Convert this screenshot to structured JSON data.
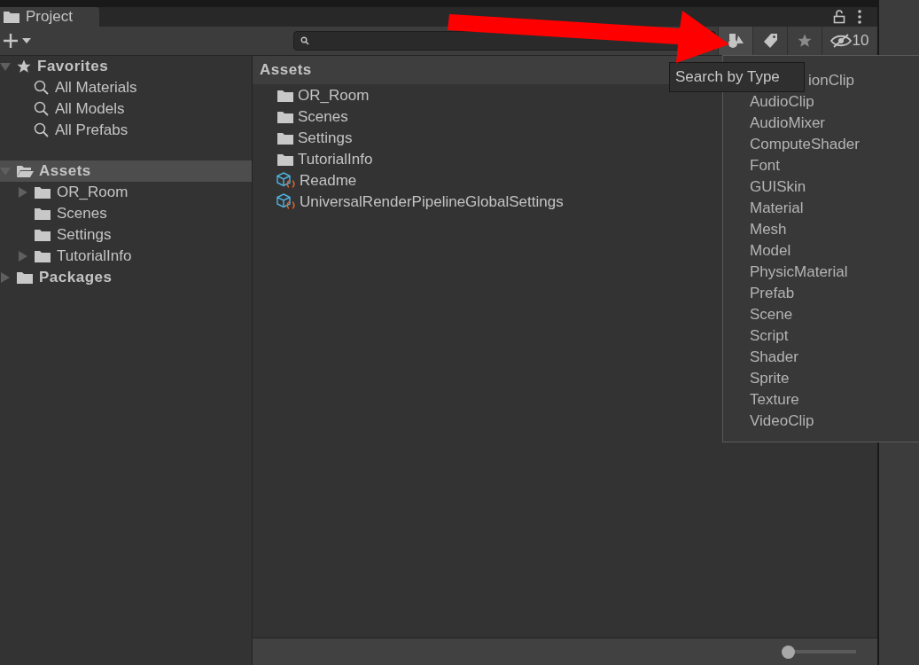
{
  "window": {
    "tab": "Project"
  },
  "filter_buttons": [
    {
      "kind": "type"
    },
    {
      "kind": "label"
    },
    {
      "kind": "favorite"
    },
    {
      "kind": "hidden",
      "count": "10"
    }
  ],
  "tree": [
    {
      "label": "Favorites",
      "kind": "favorites",
      "expanded": true,
      "selected": false,
      "children": [
        {
          "label": "All Materials",
          "kind": "search"
        },
        {
          "label": "All Models",
          "kind": "search"
        },
        {
          "label": "All Prefabs",
          "kind": "search"
        }
      ]
    },
    {
      "label": "Assets",
      "kind": "open-folder",
      "expanded": true,
      "selected": true,
      "children": [
        {
          "label": "OR_Room",
          "kind": "folder",
          "expanded": false
        },
        {
          "label": "Scenes",
          "kind": "folder"
        },
        {
          "label": "Settings",
          "kind": "folder"
        },
        {
          "label": "TutorialInfo",
          "kind": "folder",
          "expanded": false
        }
      ]
    },
    {
      "label": "Packages",
      "kind": "folder",
      "expanded": false,
      "selected": false
    }
  ],
  "content": {
    "title": "Assets",
    "items": [
      {
        "label": "OR_Room",
        "kind": "folder"
      },
      {
        "label": "Scenes",
        "kind": "folder"
      },
      {
        "label": "Settings",
        "kind": "folder"
      },
      {
        "label": "TutorialInfo",
        "kind": "folder"
      },
      {
        "label": "Readme",
        "kind": "asset"
      },
      {
        "label": "UniversalRenderPipelineGlobalSettings",
        "kind": "asset"
      }
    ]
  },
  "tooltip": "Search by Type",
  "type_menu": {
    "items": [
      {
        "label": "ionClip",
        "partly_hidden": true
      },
      {
        "label": "AudioClip"
      },
      {
        "label": "AudioMixer"
      },
      {
        "label": "ComputeShader"
      },
      {
        "label": "Font"
      },
      {
        "label": "GUISkin"
      },
      {
        "label": "Material"
      },
      {
        "label": "Mesh"
      },
      {
        "label": "Model"
      },
      {
        "label": "PhysicMaterial"
      },
      {
        "label": "Prefab"
      },
      {
        "label": "Scene"
      },
      {
        "label": "Script"
      },
      {
        "label": "Shader"
      },
      {
        "label": "Sprite"
      },
      {
        "label": "Texture"
      },
      {
        "label": "VideoClip"
      }
    ]
  },
  "zoom_slider": {
    "level": 0
  }
}
